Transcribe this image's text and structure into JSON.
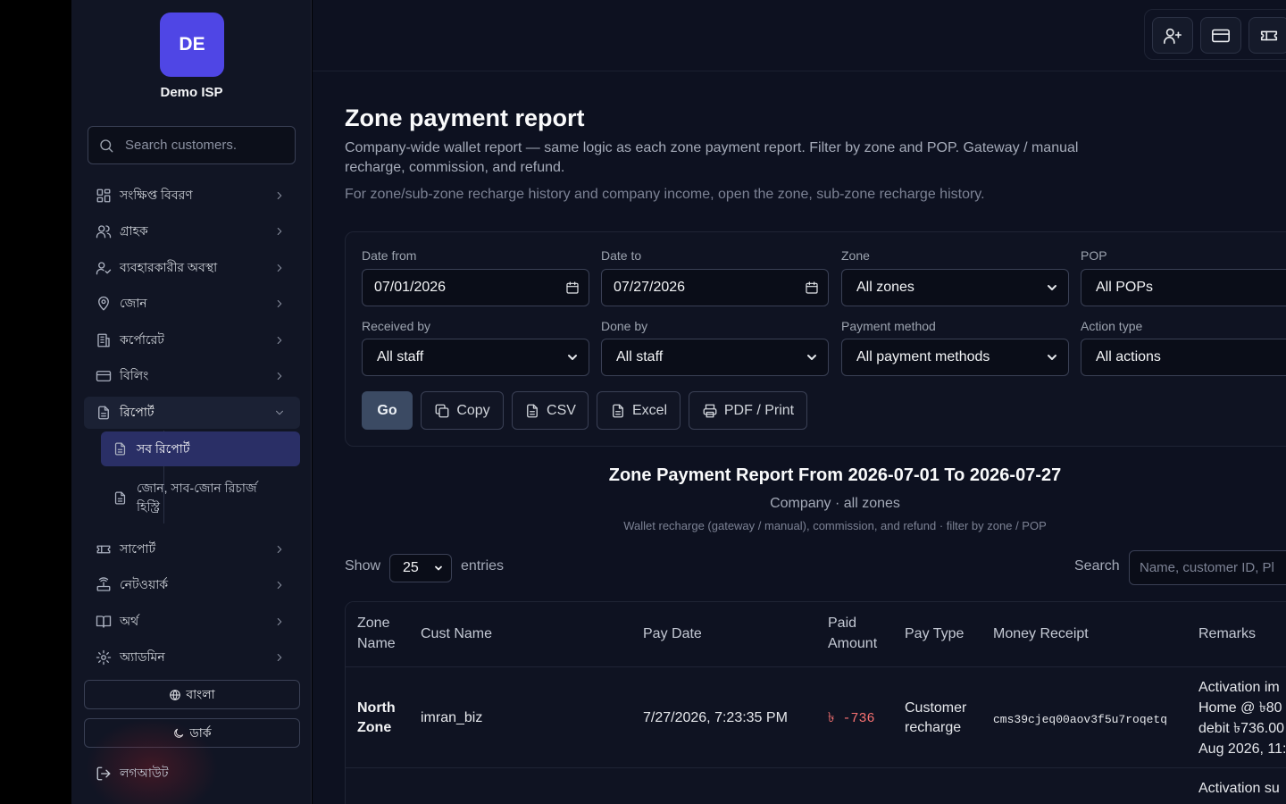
{
  "sidebar": {
    "logo_initials": "DE",
    "brand": "Demo ISP",
    "search_placeholder": "Search customers.",
    "items": [
      {
        "label": "সংক্ষিপ্ত বিবরণ"
      },
      {
        "label": "গ্রাহক"
      },
      {
        "label": "ব্যবহারকারীর অবস্থা"
      },
      {
        "label": "জোন"
      },
      {
        "label": "কর্পোরেট"
      },
      {
        "label": "বিলিং"
      },
      {
        "label": "রিপোর্ট"
      },
      {
        "label": "সাপোর্ট"
      },
      {
        "label": "নেটওয়ার্ক"
      },
      {
        "label": "অর্থ"
      },
      {
        "label": "অ্যাডমিন"
      }
    ],
    "subitems": [
      {
        "label": "সব রিপোর্ট"
      },
      {
        "label": "জোন, সাব-জোন রিচার্জ হিস্ট্রি"
      }
    ],
    "lang_button": "বাংলা",
    "theme_button": "ডার্ক",
    "logout": "লগআউট"
  },
  "header": {
    "title": "Zone payment report",
    "description": "Company-wide wallet report — same logic as each zone payment report. Filter by zone and POP. Gateway / manual recharge, commission, and refund.",
    "note": "For zone/sub-zone recharge history and company income, open the zone, sub-zone recharge history."
  },
  "filters": {
    "date_from": {
      "label": "Date from",
      "value": "07/01/2026"
    },
    "date_to": {
      "label": "Date to",
      "value": "07/27/2026"
    },
    "zone": {
      "label": "Zone",
      "value": "All zones"
    },
    "pop": {
      "label": "POP",
      "value": "All POPs"
    },
    "received_by": {
      "label": "Received by",
      "value": "All staff"
    },
    "done_by": {
      "label": "Done by",
      "value": "All staff"
    },
    "payment_method": {
      "label": "Payment method",
      "value": "All payment methods"
    },
    "action_type": {
      "label": "Action type",
      "value": "All actions"
    }
  },
  "actions": {
    "go": "Go",
    "copy": "Copy",
    "csv": "CSV",
    "excel": "Excel",
    "pdf": "PDF / Print"
  },
  "report": {
    "title": "Zone Payment Report From 2026-07-01 To 2026-07-27",
    "subtitle": "Company · all zones",
    "note": "Wallet recharge (gateway / manual), commission, and refund · filter by zone / POP"
  },
  "table_controls": {
    "show": "Show",
    "entries_value": "25",
    "entries": "entries",
    "search_label": "Search",
    "search_placeholder": "Name, customer ID, Pl"
  },
  "table": {
    "columns": [
      "Zone\nName",
      "Cust Name",
      "Pay Date",
      "Paid\nAmount",
      "Pay Type",
      "Money Receipt",
      "Remarks"
    ],
    "rows": [
      {
        "zone_name": "North Zone",
        "cust_name": "imran_biz",
        "pay_date": "7/27/2026, 7:23:35 PM",
        "paid_amount": "৳ -736",
        "pay_type": "Customer recharge",
        "money_receipt": "cms39cjeq00aov3f5u7roqetq",
        "remarks": [
          "Activation im",
          "Home @ ৳80",
          "debit ৳736.00",
          "Aug 2026, 11:"
        ]
      },
      {
        "remarks": [
          "Activation su"
        ]
      }
    ]
  },
  "colors": {
    "accent": "#4f46e5",
    "sidebar_active_sub": "#2a2f66",
    "negative": "#f87171",
    "go_button": "#3b4a63"
  }
}
